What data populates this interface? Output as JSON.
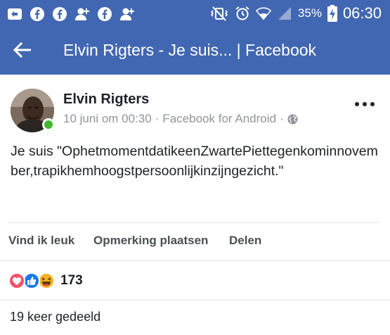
{
  "status_bar": {
    "left_icons": [
      "notification-icon",
      "facebook-icon",
      "facebook-icon",
      "add-friend-icon",
      "facebook-icon",
      "add-friend-icon"
    ],
    "right_icons": [
      "vibrate-mute-icon",
      "alarm-icon",
      "wifi-icon",
      "signal-icon",
      "battery-charging-icon"
    ],
    "battery": "35%",
    "time": "06:30"
  },
  "app_bar": {
    "title": "Elvin Rigters - Je suis... | Facebook"
  },
  "post": {
    "author": "Elvin Rigters",
    "date": "10 juni om 00:30",
    "separator": "·",
    "source": "Facebook for Android",
    "audience_icon": "globe-icon",
    "text": "Je suis \"OphetmomentdatikeenZwartePiettegenkominnovember,trapikhemhoogstpersoonlijkinzijngezicht.\""
  },
  "actions": {
    "like": "Vind ik leuk",
    "comment": "Opmerking plaatsen",
    "share": "Delen"
  },
  "reactions": {
    "icons": [
      "love-icon",
      "like-icon",
      "haha-icon"
    ],
    "count": "173"
  },
  "shares": "19 keer gedeeld",
  "colors": {
    "brand": "#4267b2",
    "love": "#f25268",
    "like": "#1877f2",
    "haha": "#f7b125",
    "online": "#42b72a",
    "meta_text": "#90949c"
  }
}
